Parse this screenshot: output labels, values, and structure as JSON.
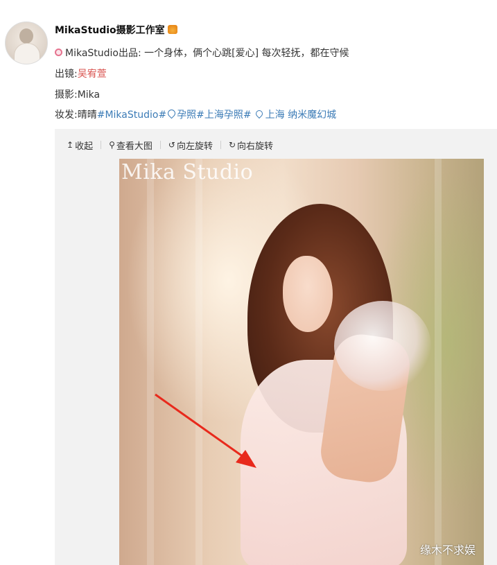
{
  "post": {
    "username": "MikaStudio摄影工作室",
    "line1": "MikaStudio出品: 一个身体，俩个心跳[爱心] 每次轻抚，都在守候",
    "model_label": "出镜:",
    "model_name": "吴宥萱",
    "photo_credit": "摄影:Mika",
    "makeup_label": "妆发:晴晴",
    "tag1": "#MikaStudio#",
    "tag2": "孕照#上海孕照#",
    "location": "上海 纳米魔幻城"
  },
  "toolbar": {
    "collapse": "收起",
    "view_large": "查看大图",
    "rotate_left": "向左旋转",
    "rotate_right": "向右旋转"
  },
  "photo": {
    "watermark": "Mika Studio"
  },
  "overlay": {
    "corner_text": "缘木不求娱"
  },
  "colors": {
    "link_blue": "#3b7bb6",
    "name_red": "#d9534f",
    "arrow_red": "#e8291c"
  },
  "icons": [
    "avatar",
    "crown-icon",
    "flower-icon",
    "collapse-icon",
    "search-icon",
    "rotate-left-icon",
    "rotate-right-icon",
    "tag-icon",
    "location-pin-icon",
    "red-arrow"
  ]
}
